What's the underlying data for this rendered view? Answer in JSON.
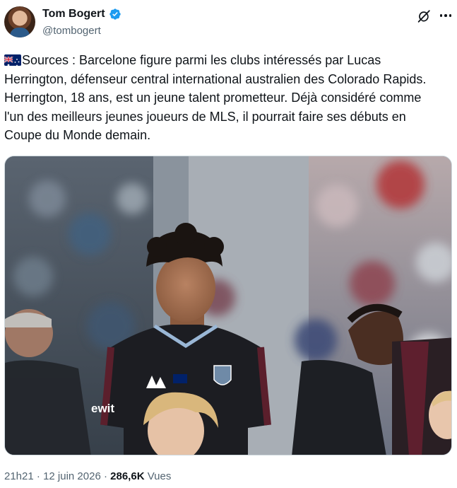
{
  "author": {
    "display_name": "Tom Bogert",
    "handle": "@tombogert"
  },
  "tweet": {
    "flag_icon": "australia-flag-icon",
    "text": "Sources : Barcelone figure parmi les clubs intéressés par Lucas Herrington, défenseur central international australien des Colorado Rapids. Herrington, 18 ans, est un jeune talent prometteur. Déjà considéré comme l'un des meilleurs jeunes joueurs de MLS, il pourrait faire ses débuts en Coupe du Monde demain.",
    "shirt_sponsor_text": "ewit"
  },
  "meta": {
    "time": "21h21",
    "separator": " · ",
    "date": "12 juin 2026",
    "views_count": "286,6K",
    "views_label": " Vues"
  },
  "colors": {
    "verified_blue": "#1d9bf0",
    "text_primary": "#0f1419",
    "text_secondary": "#536471"
  }
}
